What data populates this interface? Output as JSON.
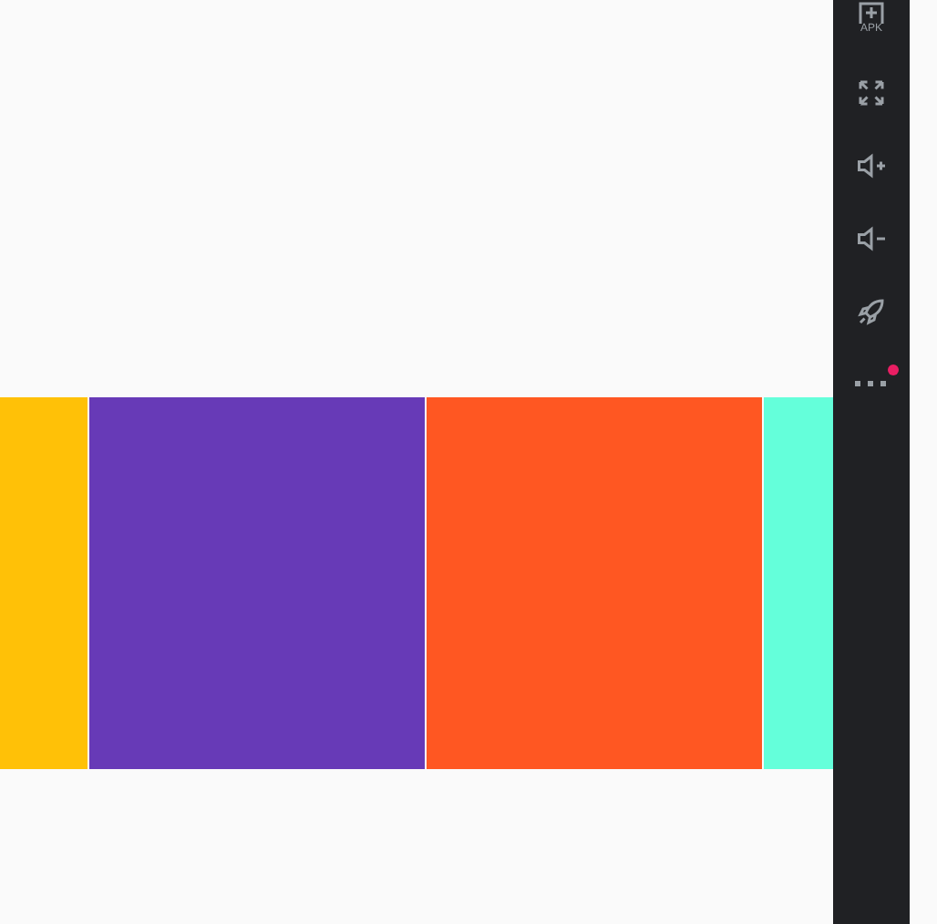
{
  "swatches": [
    {
      "color": "#ffc107"
    },
    {
      "color": "#673ab7"
    },
    {
      "color": "#ff5722"
    },
    {
      "color": "#64ffda"
    }
  ],
  "toolbar": [
    {
      "kind": "apk",
      "label": "APK"
    },
    {
      "kind": "fullscreen"
    },
    {
      "kind": "volume_up"
    },
    {
      "kind": "volume_down"
    },
    {
      "kind": "rocket"
    },
    {
      "kind": "more",
      "badge": true
    }
  ]
}
